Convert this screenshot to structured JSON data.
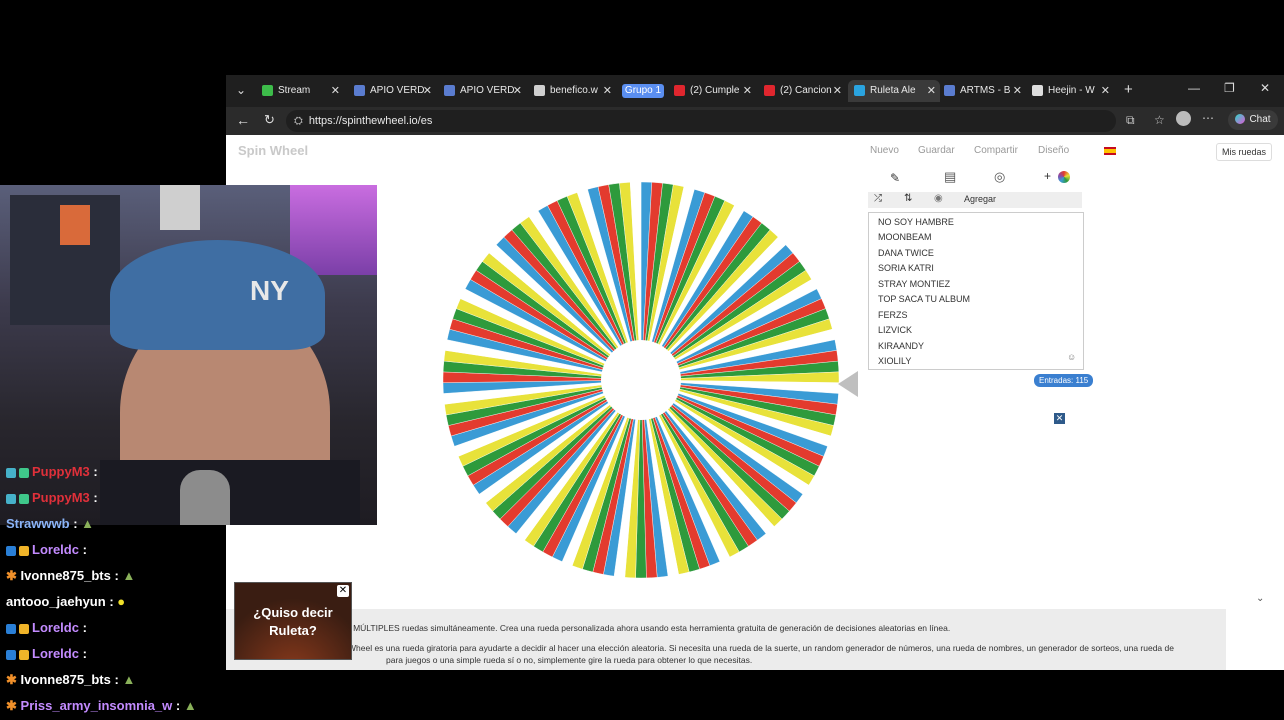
{
  "browser": {
    "tabs": [
      {
        "label": "Stream",
        "color": "#3dbc4a"
      },
      {
        "label": "APIO VERD",
        "color": "#5a7ccf"
      },
      {
        "label": "APIO VERD",
        "color": "#5a7ccf"
      },
      {
        "label": "benefico.w",
        "color": "#cfcfcf"
      },
      {
        "label": "Grupo 1",
        "color": "#5a8ef0"
      },
      {
        "label": "(2) Cumple",
        "color": "#e0262e"
      },
      {
        "label": "(2) Cancion",
        "color": "#e0262e"
      },
      {
        "label": "Ruleta Ale",
        "color": "#2aa4e0"
      },
      {
        "label": "ARTMS - B",
        "color": "#5a7ccf"
      },
      {
        "label": "Heejin - W",
        "color": "#dddddd"
      }
    ],
    "url": "https://spinthewheel.io/es",
    "chat_button": "Chat"
  },
  "site": {
    "logo": "Spin Wheel",
    "nav": [
      "Nuevo",
      "Guardar",
      "Compartir",
      "Diseño"
    ],
    "my_wheels": "Mis ruedas",
    "add_label": "Agregar",
    "entries_label": "Entradas: 115",
    "entries": [
      "NO SOY HAMBRE",
      "MOONBEAM",
      "DANA TWICE",
      "SORIA KATRI",
      "STRAY MONTIEZ",
      "TOP SACA TU ALBUM",
      "FERZS",
      "LIZVICK",
      "KIRAANDY",
      "XIOLILY"
    ],
    "description_1": "o MÚLTIPLES ruedas simultáneamente. Crea una rueda personalizada ahora usando esta herramienta gratuita de generación de decisiones aleatorias en línea.",
    "description_2": "Wheel es una rueda giratoria para ayudarte a decidir al hacer una elección aleatoria. Si necesita una rueda de la suerte, un random generador de números, una rueda de nombres, un generador de sorteos, una rueda de",
    "description_3": "para juegos o una simple rueda sí o no, simplemente gire la rueda para obtener lo que necesitas.",
    "wheel_colors": [
      "#3a9bd5",
      "#e33b2e",
      "#2e9a3c",
      "#e8e23a",
      "#ffffff",
      "#8a4aa8"
    ]
  },
  "popup": {
    "line1": "¿Quiso decir",
    "line2": "Ruleta?"
  },
  "chat": [
    {
      "user": "PuppyM3",
      "msg": ":",
      "color": "#e0303a"
    },
    {
      "user": "PuppyM3",
      "msg": ":",
      "color": "#e0303a"
    },
    {
      "user": "Strawwwb",
      "msg": ":",
      "color": "#8ab4f8"
    },
    {
      "user": "Loreldc",
      "msg": ":",
      "color": "#c38bff"
    },
    {
      "user": "Ivonne875_bts",
      "msg": ":",
      "color": "#ffffff"
    },
    {
      "user": "antooo_jaehyun",
      "msg": ":",
      "color": "#ffffff"
    },
    {
      "user": "Loreldc",
      "msg": ":",
      "color": "#c38bff"
    },
    {
      "user": "Loreldc",
      "msg": ":",
      "color": "#c38bff"
    },
    {
      "user": "Ivonne875_bts",
      "msg": ":",
      "color": "#ffffff"
    },
    {
      "user": "Priss_army_insomnia_w",
      "msg": ":",
      "color": "#c38bff"
    }
  ]
}
